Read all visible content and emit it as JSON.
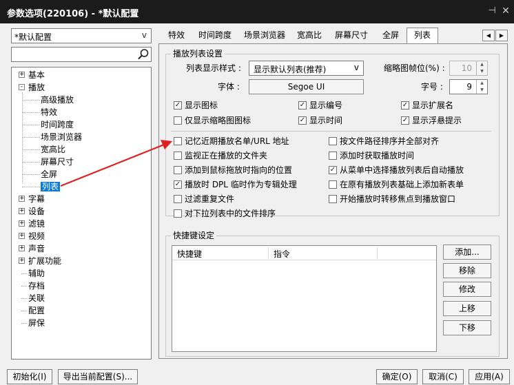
{
  "window": {
    "title": "参数选项(220106) - *默认配置"
  },
  "profile": {
    "value": "*默认配置"
  },
  "search": {
    "value": "",
    "placeholder": ""
  },
  "tree": {
    "items": [
      {
        "label": "基本",
        "level": 0,
        "expander": "+"
      },
      {
        "label": "播放",
        "level": 0,
        "expander": "-"
      },
      {
        "label": "高级播放",
        "level": 1
      },
      {
        "label": "特效",
        "level": 1
      },
      {
        "label": "时间跨度",
        "level": 1
      },
      {
        "label": "场景浏览器",
        "level": 1
      },
      {
        "label": "宽高比",
        "level": 1
      },
      {
        "label": "屏幕尺寸",
        "level": 1
      },
      {
        "label": "全屏",
        "level": 1
      },
      {
        "label": "列表",
        "level": 1,
        "selected": true
      },
      {
        "label": "字幕",
        "level": 0,
        "expander": "+"
      },
      {
        "label": "设备",
        "level": 0,
        "expander": "+"
      },
      {
        "label": "滤镜",
        "level": 0,
        "expander": "+"
      },
      {
        "label": "视频",
        "level": 0,
        "expander": "+"
      },
      {
        "label": "声音",
        "level": 0,
        "expander": "+"
      },
      {
        "label": "扩展功能",
        "level": 0,
        "expander": "+"
      },
      {
        "label": "辅助",
        "level": 0
      },
      {
        "label": "存档",
        "level": 0
      },
      {
        "label": "关联",
        "level": 0
      },
      {
        "label": "配置",
        "level": 0
      },
      {
        "label": "屏保",
        "level": 0
      }
    ]
  },
  "tabs": [
    {
      "label": "特效"
    },
    {
      "label": "时间跨度"
    },
    {
      "label": "场景浏览器"
    },
    {
      "label": "宽高比"
    },
    {
      "label": "屏幕尺寸"
    },
    {
      "label": "全屏"
    },
    {
      "label": "列表",
      "active": true
    }
  ],
  "tab_scroll": {
    "left": "◀",
    "right": "▶"
  },
  "playlist_settings": {
    "group_title": "播放列表设置",
    "display_style_label": "列表显示样式 :",
    "display_style_value": "显示默认列表(推荐)",
    "thumb_frame_label": "缩略图帧位(%) :",
    "thumb_frame_value": "10",
    "font_label": "字体 :",
    "font_value": "Segoe UI",
    "font_size_label": "字号 :",
    "font_size_value": "9",
    "checkboxes": [
      {
        "label": "显示图标",
        "checked": true
      },
      {
        "label": "显示编号",
        "checked": true
      },
      {
        "label": "显示扩展名",
        "checked": true
      },
      {
        "label": "仅显示缩略图图标",
        "checked": false
      },
      {
        "label": "显示时间",
        "checked": true
      },
      {
        "label": "显示浮悬提示",
        "checked": true
      }
    ]
  },
  "options": [
    {
      "label": "记忆近期播放名单/URL 地址",
      "checked": false
    },
    {
      "label": "按文件路径排序并全部对齐",
      "checked": false
    },
    {
      "label": "监视正在播放的文件夹",
      "checked": false
    },
    {
      "label": "添加时获取播放时间",
      "checked": false
    },
    {
      "label": "添加到鼠标拖放时指向的位置",
      "checked": false
    },
    {
      "label": "从菜单中选择播放列表后自动播放",
      "checked": true
    },
    {
      "label": "播放时 DPL 临时作为专辑处理",
      "checked": true
    },
    {
      "label": "在原有播放列表基础上添加新表单",
      "checked": false
    },
    {
      "label": "过滤重复文件",
      "checked": false
    },
    {
      "label": "开始播放时转移焦点到播放窗口",
      "checked": false
    },
    {
      "label": "对下拉列表中的文件排序",
      "checked": false
    }
  ],
  "hotkeys": {
    "group_title": "快捷键设定",
    "col_hotkey": "快捷键",
    "col_command": "指令",
    "buttons": {
      "add": "添加...",
      "remove": "移除",
      "modify": "修改",
      "up": "上移",
      "down": "下移"
    }
  },
  "footer": {
    "init": "初始化(I)",
    "export": "导出当前配置(S)...",
    "ok": "确定(O)",
    "cancel": "取消(C)",
    "apply": "应用(A)"
  },
  "colors": {
    "selection": "#0a7bd6",
    "arrow": "#e02020",
    "titlebar": "#1b1b1b"
  }
}
